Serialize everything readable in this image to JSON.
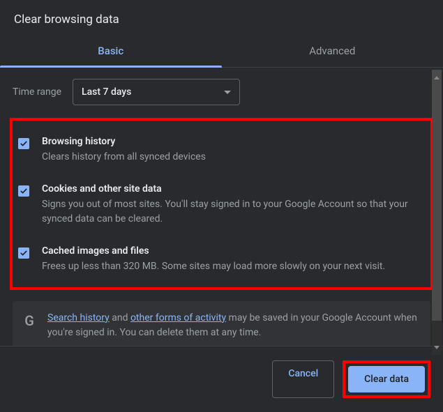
{
  "title": "Clear browsing data",
  "tabs": {
    "basic": "Basic",
    "advanced": "Advanced"
  },
  "time": {
    "label": "Time range",
    "value": "Last 7 days"
  },
  "items": [
    {
      "title": "Browsing history",
      "desc": "Clears history from all synced devices"
    },
    {
      "title": "Cookies and other site data",
      "desc": "Signs you out of most sites. You'll stay signed in to your Google Account so that your synced data can be cleared."
    },
    {
      "title": "Cached images and files",
      "desc": "Frees up less than 320 MB. Some sites may load more slowly on your next visit."
    }
  ],
  "info": {
    "link1": "Search history",
    "mid1": " and ",
    "link2": "other forms of activity",
    "mid2": " may be saved in your Google Account when you're signed in. You can delete them at any time."
  },
  "buttons": {
    "cancel": "Cancel",
    "clear": "Clear data"
  }
}
